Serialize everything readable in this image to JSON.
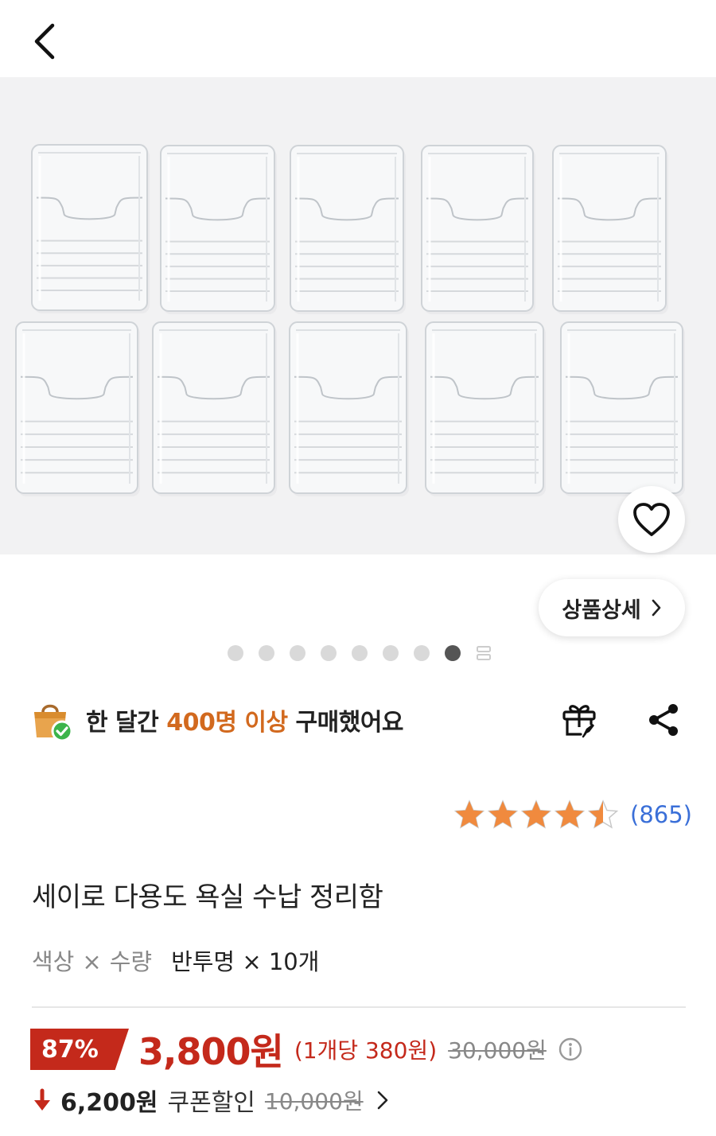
{
  "topbar": {
    "back_icon": "chevron-left-icon"
  },
  "gallery": {
    "image_alt": "transparent storage bins",
    "dots_count": 8,
    "active_dot": 8,
    "detail_button_label": "상품상세",
    "wishlist_icon": "heart-outline-icon"
  },
  "purchase_badge": {
    "prefix": "한 달간 ",
    "highlight": "400명 이상",
    "suffix": " 구매했어요",
    "highlight_color": "#d2691e"
  },
  "actions": {
    "gift_icon": "gift-icon",
    "share_icon": "share-icon"
  },
  "rating": {
    "stars": 4.5,
    "count": "(865)",
    "star_color": "#f08a3e"
  },
  "product": {
    "title": "세이로 다용도 욕실 수납 정리함",
    "option_key1": "색상",
    "option_sep1": "×",
    "option_key2": "수량",
    "option_value": "반투명 × 10개"
  },
  "price": {
    "discount": "87%",
    "sale_price": "3,800원",
    "unit_price": "(1개당 380원)",
    "original_price": "30,000원",
    "accent": "#c4291b"
  },
  "coupon": {
    "price": "6,200원",
    "label": "쿠폰할인",
    "original": "10,000원"
  }
}
